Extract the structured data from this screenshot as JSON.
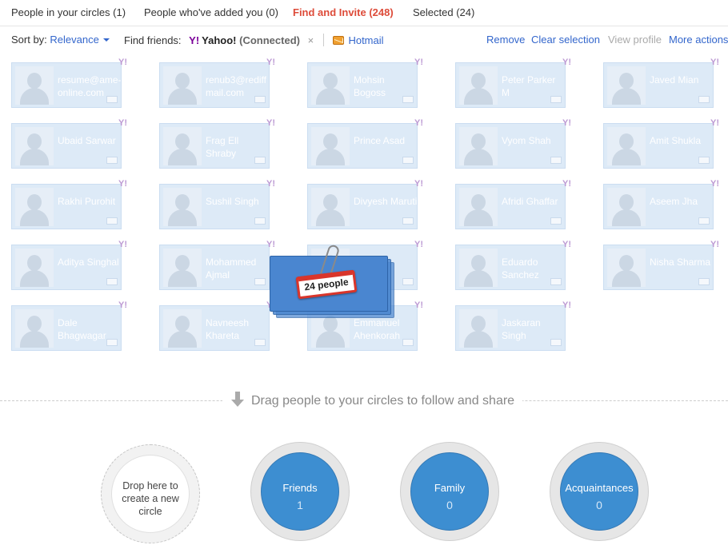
{
  "tabs": [
    {
      "label": "People in your circles (1)",
      "active": false
    },
    {
      "label": "People who've added you (0)",
      "active": false
    },
    {
      "label": "Find and Invite (248)",
      "active": true
    },
    {
      "label": "Selected (24)",
      "active": false
    }
  ],
  "toolbar": {
    "sort_label": "Sort by:",
    "sort_value": "Relevance",
    "find_label": "Find friends:",
    "yahoo_logo": "Y!",
    "yahoo_name": "Yahoo!",
    "yahoo_status": "(Connected)",
    "remove_x": "×",
    "hotmail": "Hotmail",
    "remove": "Remove",
    "clear_selection": "Clear selection",
    "view_profile": "View profile",
    "more_actions": "More actions"
  },
  "people": [
    "resume@ame-online.com",
    "renub3@rediffmail.com",
    "Mohsin Bogoss",
    "Peter Parker M",
    "Javed Mian",
    "Ubaid Sarwar",
    "Frag Ell Shraby",
    "Prince Asad",
    "Vyom Shah",
    "Amit Shukla",
    "Rakhi Purohit",
    "Sushil Singh",
    "Divyesh Maruti",
    "Afridi Ghaffar",
    "Aseem Jha",
    "Aditya Singhal",
    "Mohammed Ajmal",
    "Kin",
    "Eduardo Sanchez",
    "Nisha Sharma",
    "Dale Bhagwagar",
    "Navneesh Khareta",
    "Emmanuel Ahenkorah",
    "Jaskaran Singh"
  ],
  "card_badge": "Y!",
  "drag_stack": {
    "label": "24 people"
  },
  "drag_hint": "Drag people to your circles to follow and share",
  "circles": {
    "new_circle": "Drop here to create a new circle",
    "friends": {
      "name": "Friends",
      "count": "1"
    },
    "family": {
      "name": "Family",
      "count": "0"
    },
    "acquaintances": {
      "name": "Acquaintances",
      "count": "0"
    }
  },
  "colors": {
    "active_tab": "#dd4b39",
    "link": "#3366cc",
    "circle_fill": "#3d8ed1",
    "card_fill": "#dae8f7"
  }
}
